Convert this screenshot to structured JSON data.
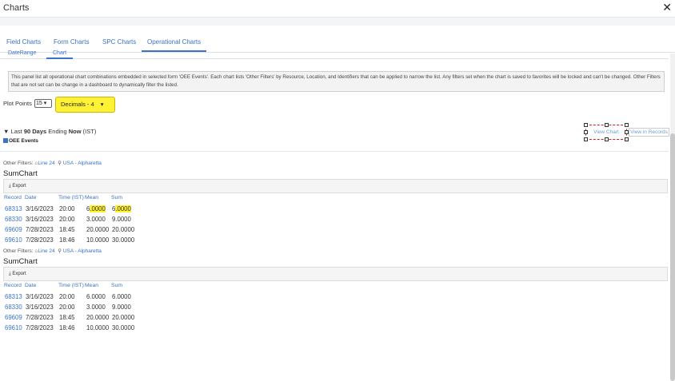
{
  "window": {
    "title": "Charts"
  },
  "tabs": [
    "Field Charts",
    "Form Charts",
    "SPC Charts",
    "Operational Charts"
  ],
  "subtabs": [
    "DateRange",
    "Chart"
  ],
  "info_text": "This panel list all operational chart combinations embedded in selected form 'OEE Events'. Each chart lists 'Other Filters' by Resource, Location, and Identifiers that can be applied to narrow the list. Any filters set when the chart is saved to favorites will be locked and can't be changed. Other Filters that are not set can be change in a dashboard to dynamically filter the listed.",
  "plot_points": {
    "label": "Plot Points",
    "value": "15"
  },
  "decimals": {
    "value": "Decimals - 4",
    "highlight": "#fff234"
  },
  "filter_line": {
    "prefix": "Last",
    "days": "90 Days",
    "mid": "Ending",
    "now": "Now",
    "tz": "(IST)"
  },
  "form_name": "OEE Events",
  "buttons": {
    "view_chart": "View Chart",
    "view_records": "View in Records",
    "export": "Export"
  },
  "other_filters_label": "Other Filters:",
  "charts": [
    {
      "resource": "Line 24",
      "location": "USA - Alpharetta",
      "title": "SumChart",
      "columns": [
        "Record",
        "Date",
        "Time (IST)",
        "Mean",
        "Sum"
      ],
      "rows": [
        [
          "68313",
          "3/16/2023",
          "20:00",
          "6.0000",
          "6.0000"
        ],
        [
          "68330",
          "3/16/2023",
          "20:00",
          "3.0000",
          "9.0000"
        ],
        [
          "69609",
          "7/28/2023",
          "18:45",
          "20.0000",
          "20.0000"
        ],
        [
          "69610",
          "7/28/2023",
          "18:46",
          "10.0000",
          "30.0000"
        ]
      ]
    },
    {
      "resource": "Line 24",
      "location": "USA - Alpharetta",
      "title": "SumChart",
      "columns": [
        "Record",
        "Date",
        "Time (IST)",
        "Mean",
        "Sum"
      ],
      "rows": [
        [
          "68313",
          "3/16/2023",
          "20:00",
          "6.0000",
          "6.0000"
        ],
        [
          "68330",
          "3/16/2023",
          "20:00",
          "3.0000",
          "9.0000"
        ],
        [
          "69609",
          "7/28/2023",
          "18:45",
          "20.0000",
          "20.0000"
        ],
        [
          "69610",
          "7/28/2023",
          "18:46",
          "10.0000",
          "30.0000"
        ]
      ]
    }
  ]
}
